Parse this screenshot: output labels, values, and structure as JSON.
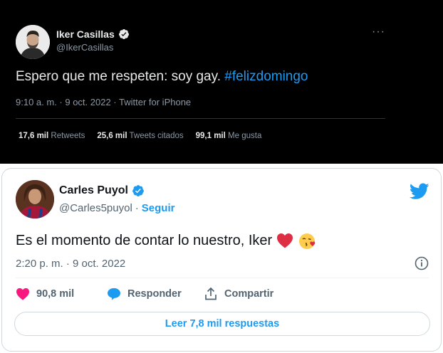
{
  "tweet_dark": {
    "author": {
      "name": "Iker Casillas",
      "handle": "@IkerCasillas",
      "verified": true
    },
    "text": "Espero que me respeten: soy gay.",
    "hashtag": "#felizdomingo",
    "meta": "9:10 a. m. · 9 oct. 2022 · Twitter for iPhone",
    "more_icon": "more-dots-icon",
    "stats": [
      {
        "count": "17,6 mil",
        "label": "Retweets"
      },
      {
        "count": "25,6 mil",
        "label": "Tweets citados"
      },
      {
        "count": "99,1 mil",
        "label": "Me gusta"
      }
    ],
    "colors": {
      "background": "#000000",
      "text": "#e7e9ea",
      "secondary": "#8b98a5",
      "link": "#1d9bf0"
    }
  },
  "tweet_light": {
    "author": {
      "name": "Carles Puyol",
      "handle": "@Carles5puyol",
      "verified": true
    },
    "separator": "·",
    "follow_label": "Seguir",
    "text": "Es el momento de contar lo nuestro, Iker",
    "emojis": [
      "red-heart-emoji",
      "face-blowing-kiss-emoji"
    ],
    "meta": "2:20 p. m. · 9 oct. 2022",
    "icons": {
      "brand": "twitter-bird-icon",
      "info": "info-icon"
    },
    "actions": {
      "like_count": "90,8 mil",
      "reply_label": "Responder",
      "share_label": "Compartir"
    },
    "replies_button": "Leer 7,8 mil respuestas",
    "colors": {
      "background": "#ffffff",
      "text": "#0f1419",
      "secondary": "#536471",
      "accent": "#1d9bf0",
      "like": "#f91880"
    }
  }
}
